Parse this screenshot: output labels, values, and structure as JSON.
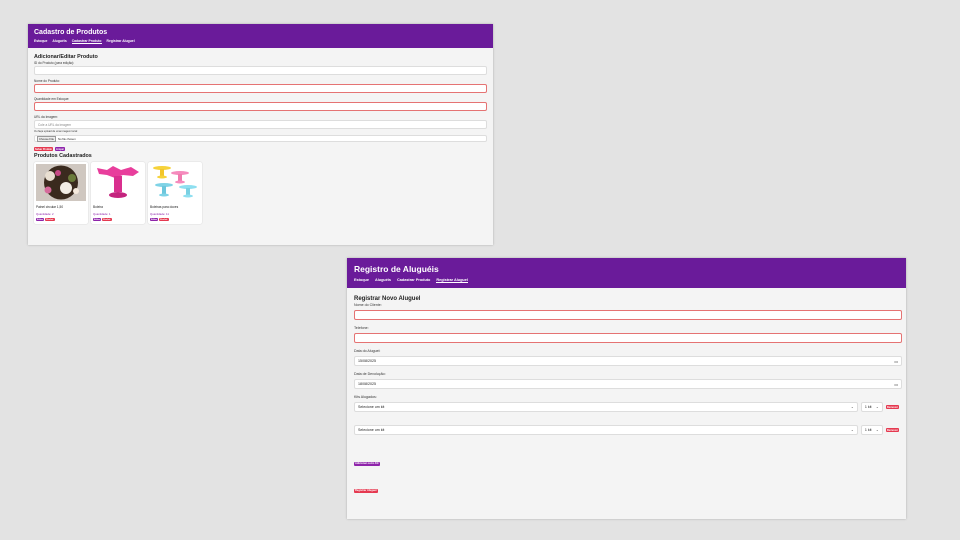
{
  "products_window": {
    "title": "Cadastro de Produtos",
    "nav": [
      "Estoque",
      "Aluguéis",
      "Cadastrar Produto",
      "Registrar Aluguel"
    ],
    "active_nav": 2,
    "form_title": "Adicionar/Editar Produto",
    "id_label": "ID do Produto (para edição):",
    "name_label": "Nome do Produto:",
    "qty_label": "Quantidade em Estoque:",
    "url_label": "URL da Imagem:",
    "url_placeholder": "Cole a URL da imagem",
    "upload_hint": "Ou faça upload de uma imagem local:",
    "choose_file": "Choose File",
    "no_file": "No file chosen",
    "save_button": "Salvar Produto",
    "clear_button": "Limpar",
    "list_title": "Produtos Cadastrados",
    "products": [
      {
        "name": "Painel circular 1,50",
        "qty": "Quantidade: 2",
        "edit": "Editar",
        "delete": "Excluir"
      },
      {
        "name": "Boleira",
        "qty": "Quantidade: 1",
        "edit": "Editar",
        "delete": "Excluir"
      },
      {
        "name": "Boleiras para doces",
        "qty": "Quantidade: 11",
        "edit": "Editar",
        "delete": "Excluir"
      }
    ]
  },
  "rental_window": {
    "title": "Registro de Aluguéis",
    "nav": [
      "Estoque",
      "Aluguéis",
      "Cadastrar Produto",
      "Registrar Aluguel"
    ],
    "active_nav": 3,
    "form_title": "Registrar Novo Aluguel",
    "client_label": "Nome do Cliente:",
    "phone_label": "Telefone:",
    "rent_date_label": "Data do Aluguel:",
    "rent_date": "15/08/2025",
    "return_date_label": "Data de Devolução:",
    "return_date": "18/08/2025",
    "kits_label": "Kits Alugados:",
    "kits": [
      {
        "select": "Selecione um kit",
        "qty": "1 kit",
        "remove": "Remover"
      },
      {
        "select": "Selecione um kit",
        "qty": "1 kit",
        "remove": "Remover"
      }
    ],
    "add_kit_button": "Adicionar outro Kit",
    "submit_button": "Registrar Aluguel"
  }
}
